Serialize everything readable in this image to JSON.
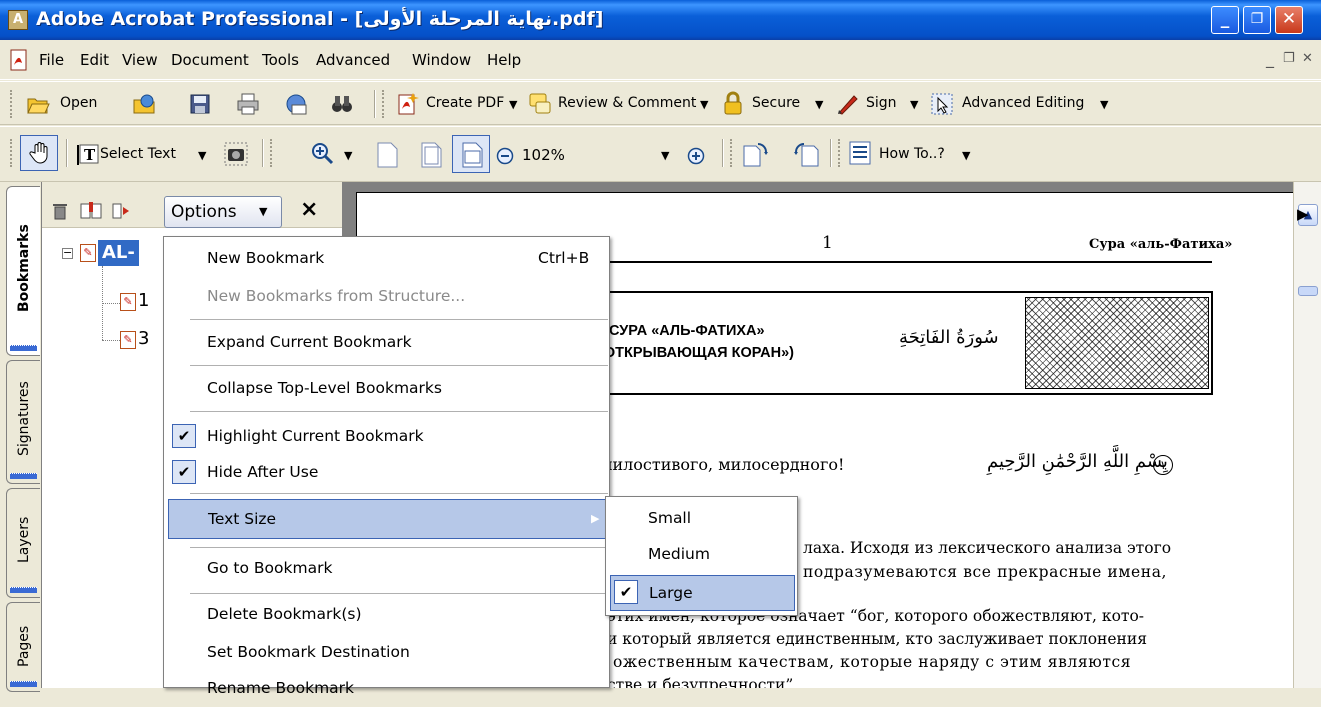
{
  "window": {
    "title": "Adobe Acrobat Professional - [نهاية المرحلة الأولى.pdf]",
    "minimize": "_",
    "restore": "❐",
    "close": "✕"
  },
  "menubar": {
    "items": [
      "File",
      "Edit",
      "View",
      "Document",
      "Tools",
      "Advanced",
      "Window",
      "Help"
    ],
    "doc_min": "_",
    "doc_restore": "❐",
    "doc_close": "✕"
  },
  "toolbar1": {
    "open": "Open",
    "create_pdf": "Create PDF",
    "review_comment": "Review & Comment",
    "secure": "Secure",
    "sign": "Sign",
    "advanced_editing": "Advanced Editing"
  },
  "toolbar2": {
    "select_text": "Select Text",
    "zoom": "102%",
    "how_to": "How To..?"
  },
  "panel_tabs": [
    "Bookmarks",
    "Signatures",
    "Layers",
    "Pages"
  ],
  "bookmarks": {
    "options_label": "Options",
    "close": "×",
    "items": [
      "AL-",
      "1",
      "3"
    ]
  },
  "options_menu": {
    "new_bookmark": "New Bookmark",
    "new_bookmark_shortcut": "Ctrl+B",
    "new_from_structure": "New Bookmarks from Structure...",
    "expand_current": "Expand Current Bookmark",
    "collapse_top": "Collapse Top-Level Bookmarks",
    "highlight_current": "Highlight Current Bookmark",
    "hide_after_use": "Hide After Use",
    "text_size": "Text Size",
    "go_to": "Go to Bookmark",
    "delete": "Delete Bookmark(s)",
    "set_destination": "Set Bookmark Destination",
    "rename": "Rename Bookmark"
  },
  "text_size_menu": {
    "small": "Small",
    "medium": "Medium",
    "large": "Large",
    "checked": "Large"
  },
  "document": {
    "page_number": "1",
    "header_right": "Сура «аль-Фатиха»",
    "banner_line1": "Сура «аль-Фатиха»",
    "banner_line2": "(«Открывающая Коран»)",
    "banner_arabic": "سُورَةُ الفَاتِحَةِ",
    "verse_ru": "милостивого, милосердного!",
    "verse_ar": "بِسْمِ اللَّهِ الرَّحْمَٰنِ الرَّحِيمِ",
    "verse_num": "١",
    "para_lines": [
      "лаха. Исходя из лексического анализа этого",
      "подразумеваются все прекрасные имена,",
      "этих имен, которое означает “бог, которого обожествляют, кото-",
      "и который является единственным, кто заслуживает поклонения",
      "ожественным качествам, которые наряду с этим являются",
      "стве и безупречности”"
    ]
  }
}
